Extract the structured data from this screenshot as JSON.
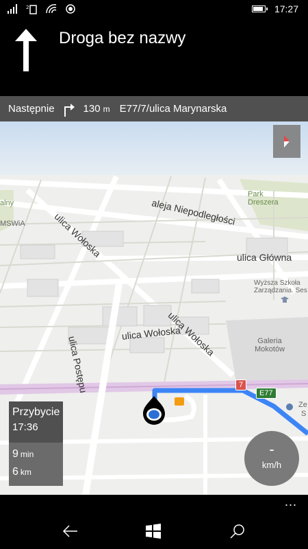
{
  "statusbar": {
    "time": "17:27",
    "battery_level": 0.9
  },
  "header": {
    "street": "Droga bez nazwy"
  },
  "next": {
    "label": "Następnie",
    "distance": "130",
    "unit": "m",
    "road": "E77/7/ulica Marynarska"
  },
  "map": {
    "labels": {
      "aleja_niepodleglosci": "aleja Niepodległości",
      "ulica_woloska_1": "ulica Wołoska",
      "ulica_woloska_2": "ulica Wołoska",
      "ulica_woloska_3": "ulica Wołoska",
      "ulica_glowna": "ulica Główna",
      "ulica_postepu": "ulica Postępu",
      "galeria": "Galeria\nMokotów",
      "park": "Park\nDreszera",
      "wyzsza": "Wyższa Szkoła\nZarządzania. Ses",
      "mswia": "MSWiA",
      "alny": "alny",
      "ze": "Ze",
      "s": "S"
    },
    "shields": {
      "red": "7",
      "green": "E77"
    }
  },
  "arrival": {
    "title": "Przybycie",
    "time": "17:36",
    "duration_value": "9",
    "duration_unit": "min",
    "distance_value": "6",
    "distance_unit": "km"
  },
  "speed": {
    "value": "-",
    "unit": "km/h"
  },
  "appbar": {
    "more": "..."
  },
  "navbar": {
    "back": "back-icon",
    "home": "windows-icon",
    "search": "search-icon"
  }
}
